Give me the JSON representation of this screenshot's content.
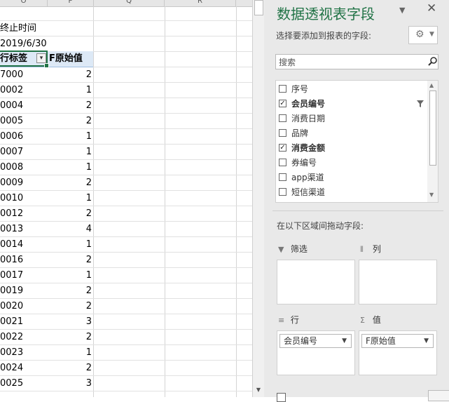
{
  "sheet": {
    "columns": [
      "O",
      "P",
      "Q",
      "R"
    ],
    "label_rows": [
      {
        "a": "终止时间",
        "b": ""
      },
      {
        "a": "2019/6/30",
        "b": ""
      }
    ],
    "header": {
      "row_label": "行标签",
      "value_label": "F原始值"
    },
    "rows": [
      {
        "k": "7000",
        "v": "2"
      },
      {
        "k": "0002",
        "v": "1"
      },
      {
        "k": "0004",
        "v": "2"
      },
      {
        "k": "0005",
        "v": "2"
      },
      {
        "k": "0006",
        "v": "1"
      },
      {
        "k": "0007",
        "v": "1"
      },
      {
        "k": "0008",
        "v": "1"
      },
      {
        "k": "0009",
        "v": "2"
      },
      {
        "k": "0010",
        "v": "1"
      },
      {
        "k": "0012",
        "v": "2"
      },
      {
        "k": "0013",
        "v": "4"
      },
      {
        "k": "0014",
        "v": "1"
      },
      {
        "k": "0016",
        "v": "2"
      },
      {
        "k": "0017",
        "v": "1"
      },
      {
        "k": "0019",
        "v": "2"
      },
      {
        "k": "0020",
        "v": "2"
      },
      {
        "k": "0021",
        "v": "3"
      },
      {
        "k": "0022",
        "v": "2"
      },
      {
        "k": "0023",
        "v": "1"
      },
      {
        "k": "0024",
        "v": "2"
      },
      {
        "k": "0025",
        "v": "3"
      }
    ]
  },
  "pane": {
    "title": "数据透视表字段",
    "subtitle": "选择要添加到报表的字段:",
    "search_placeholder": "搜索",
    "fields": [
      {
        "label": "序号",
        "checked": false
      },
      {
        "label": "会员编号",
        "checked": true
      },
      {
        "label": "消费日期",
        "checked": false
      },
      {
        "label": "品牌",
        "checked": false
      },
      {
        "label": "消费金额",
        "checked": true
      },
      {
        "label": "券编号",
        "checked": false
      },
      {
        "label": "app渠道",
        "checked": false
      },
      {
        "label": "短信渠道",
        "checked": false
      }
    ],
    "drag_label": "在以下区域间拖动字段:",
    "areas": {
      "filter": {
        "label": "筛选"
      },
      "columns": {
        "label": "列"
      },
      "rows": {
        "label": "行",
        "chip": "会员编号"
      },
      "values": {
        "label": "值",
        "chip": "F原始值"
      }
    },
    "colors": {
      "accent": "#217346",
      "pane_bg": "#e9e9e9"
    }
  }
}
